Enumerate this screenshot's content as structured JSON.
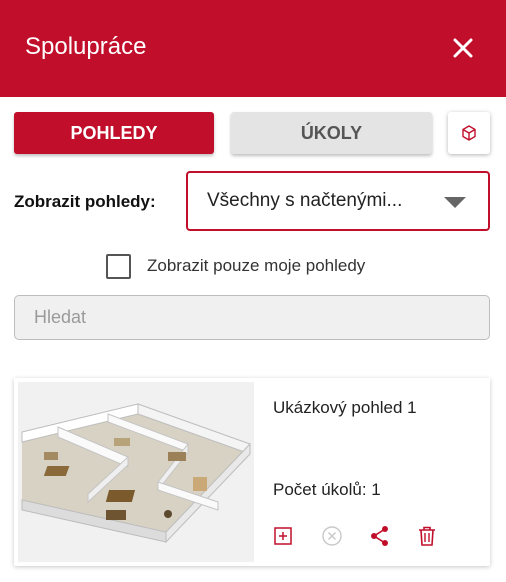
{
  "header": {
    "title": "Spolupráce",
    "close_icon": "close-icon"
  },
  "tabs": {
    "views": "POHLEDY",
    "tasks": "ÚKOLY",
    "cube_icon": "cube-icon"
  },
  "filter": {
    "label": "Zobrazit pohledy:",
    "selected": "Všechny s načtenými..."
  },
  "only_mine": {
    "label": "Zobrazit pouze moje pohledy",
    "checked": false
  },
  "search": {
    "placeholder": "Hledat",
    "value": ""
  },
  "views": [
    {
      "name": "Ukázkový pohled 1",
      "task_count_label": "Počet úkolů: 1",
      "actions": [
        "add-task-icon",
        "remove-icon",
        "share-icon",
        "delete-icon"
      ]
    }
  ],
  "colors": {
    "accent": "#c10f2b",
    "tab_inactive": "#e4e4e4",
    "icon_disabled": "#c8c8c8"
  }
}
